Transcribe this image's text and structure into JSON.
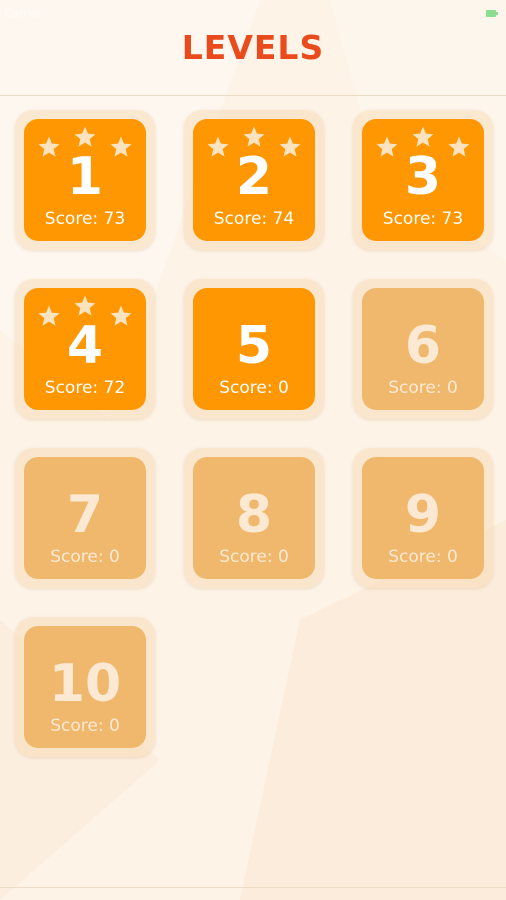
{
  "status_bar": {
    "carrier": "Carrier",
    "battery_color": "#2ecc40"
  },
  "header": {
    "title": "LEVELS",
    "title_color": "#ea4b1c"
  },
  "colors": {
    "unlocked_tile": "#ff9702",
    "locked_tile": "#f0b86c",
    "star": "#fbe3bf",
    "background": "#fdf3e7"
  },
  "levels": [
    {
      "number": "1",
      "score_label": "Score:",
      "score": "73",
      "stars": 3,
      "unlocked": true
    },
    {
      "number": "2",
      "score_label": "Score:",
      "score": "74",
      "stars": 3,
      "unlocked": true
    },
    {
      "number": "3",
      "score_label": "Score:",
      "score": "73",
      "stars": 3,
      "unlocked": true
    },
    {
      "number": "4",
      "score_label": "Score:",
      "score": "72",
      "stars": 3,
      "unlocked": true
    },
    {
      "number": "5",
      "score_label": "Score:",
      "score": "0",
      "stars": 0,
      "unlocked": true
    },
    {
      "number": "6",
      "score_label": "Score:",
      "score": "0",
      "stars": 0,
      "unlocked": false
    },
    {
      "number": "7",
      "score_label": "Score:",
      "score": "0",
      "stars": 0,
      "unlocked": false
    },
    {
      "number": "8",
      "score_label": "Score:",
      "score": "0",
      "stars": 0,
      "unlocked": false
    },
    {
      "number": "9",
      "score_label": "Score:",
      "score": "0",
      "stars": 0,
      "unlocked": false
    },
    {
      "number": "10",
      "score_label": "Score:",
      "score": "0",
      "stars": 0,
      "unlocked": false
    }
  ]
}
